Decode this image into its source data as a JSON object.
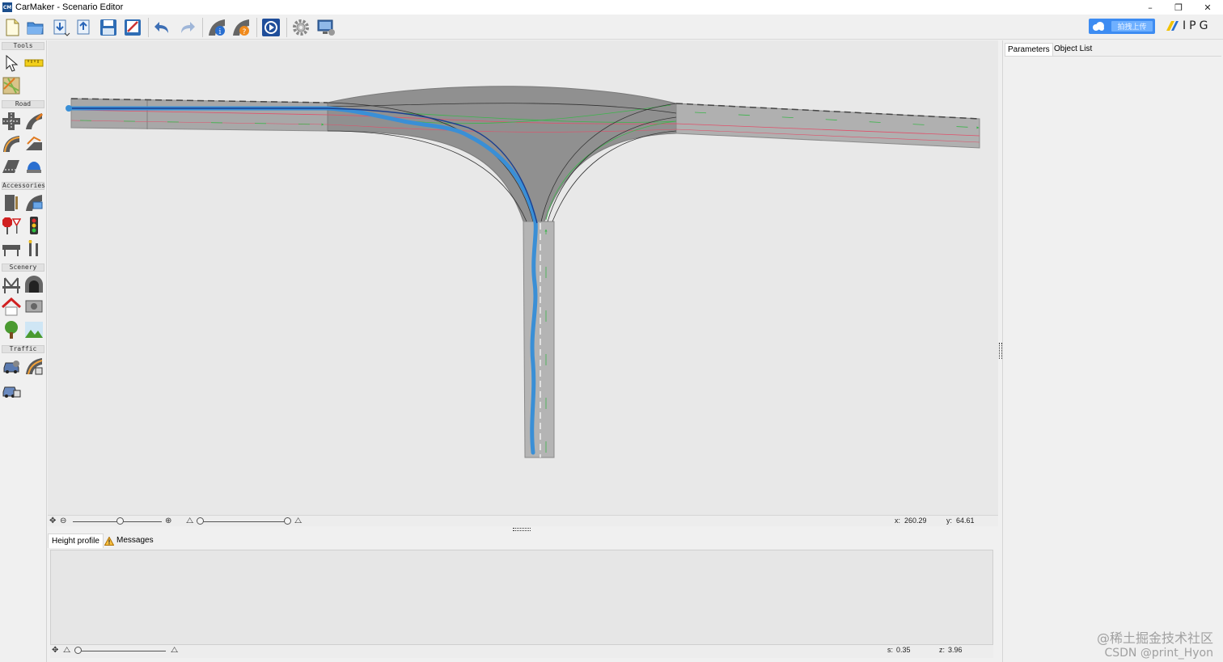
{
  "window": {
    "app_icon_text": "CM",
    "title": "CarMaker - Scenario Editor",
    "controls": [
      "–",
      "❐",
      "✕"
    ]
  },
  "toolbar": {
    "buttons": [
      "new-file",
      "open-folder",
      "import",
      "export",
      "save",
      "save-as",
      "undo",
      "redo",
      "road-info",
      "road-warning",
      "play",
      "settings",
      "display"
    ],
    "upload_label": "拍拽上传",
    "brand": "IPG"
  },
  "palette": {
    "sections": {
      "tools": "Tools",
      "road": "Road",
      "accessories": "Accessories",
      "scenery": "Scenery",
      "traffic": "Traffic"
    }
  },
  "status": {
    "x_label": "x:",
    "x_value": "260.29",
    "y_label": "y:",
    "y_value": "64.61",
    "s_label": "s:",
    "s_value": "0.35",
    "z_label": "z:",
    "z_value": "3.96"
  },
  "bottom_tabs": {
    "height_profile": "Height profile",
    "messages": "Messages"
  },
  "right_tabs": {
    "parameters": "Parameters",
    "object_list": "Object List"
  },
  "watermark": {
    "line1": "@稀土掘金技术社区",
    "line2": "CSDN @print_Hyon"
  },
  "colors": {
    "road": "#9a9a9a",
    "route": "#3a8fd6",
    "route_dark": "#1b3f8f",
    "lane_arrow": "#3cb44b",
    "ref_line": "#e0506a"
  }
}
